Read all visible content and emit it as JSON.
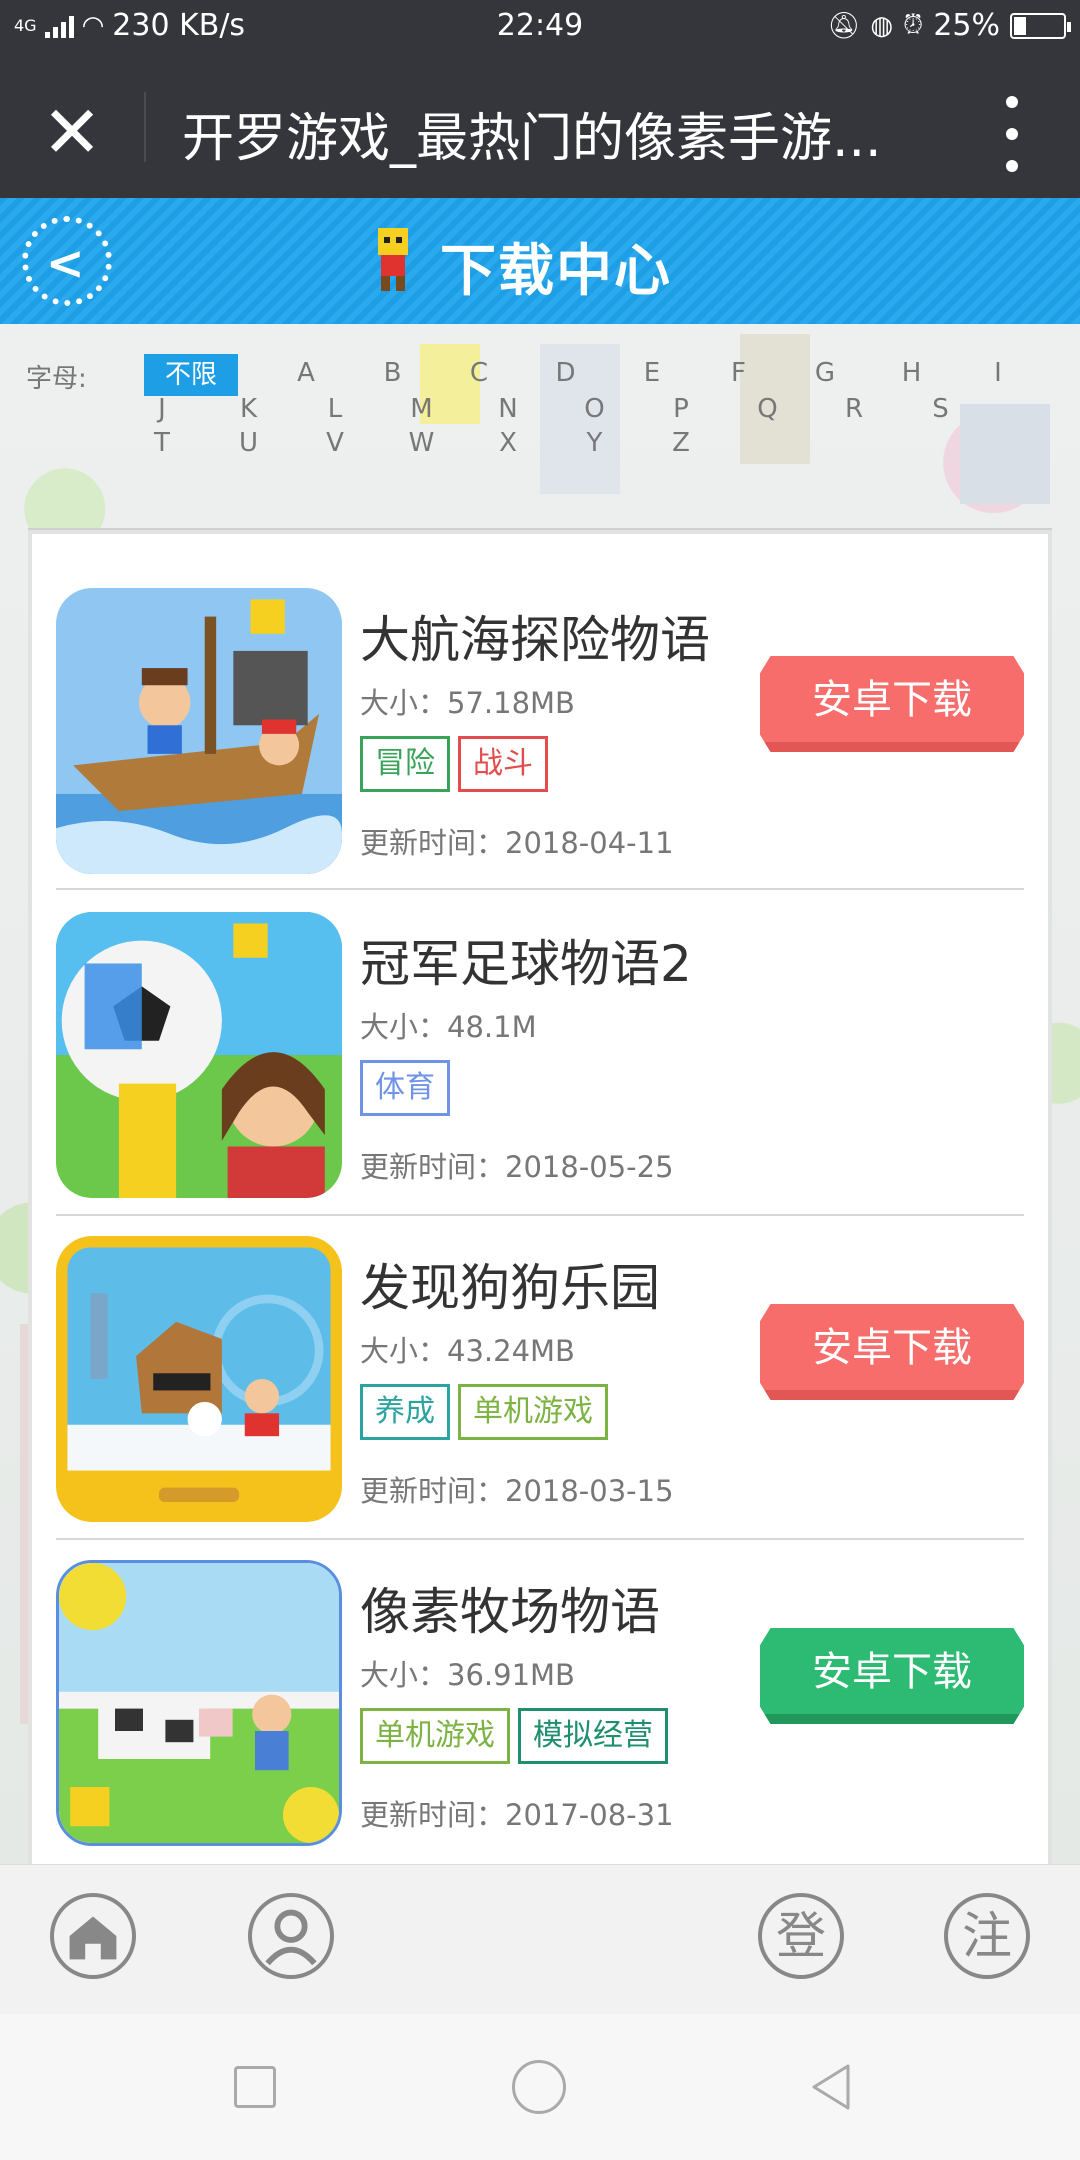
{
  "status_bar": {
    "network": "4G",
    "speed": "230 KB/s",
    "time": "22:49",
    "battery": "25%",
    "battery_level": 0.25
  },
  "title_bar": {
    "title": "开罗游戏_最热门的像素手游..."
  },
  "header": {
    "title": "下载中心"
  },
  "filter": {
    "label": "字母:",
    "selected": "不限",
    "letters": [
      "A",
      "B",
      "C",
      "D",
      "E",
      "F",
      "G",
      "H",
      "I",
      "J",
      "K",
      "L",
      "M",
      "N",
      "O",
      "P",
      "Q",
      "R",
      "S",
      "T",
      "U",
      "V",
      "W",
      "X",
      "Y",
      "Z"
    ]
  },
  "games": [
    {
      "name": "大航海探险物语",
      "size": "大小：57.18MB",
      "tags": [
        {
          "text": "冒险",
          "color": "#3aa35a"
        },
        {
          "text": "战斗",
          "color": "#e24c4c"
        }
      ],
      "date": "更新时间：2018-04-11",
      "button": "安卓下载",
      "button_color": "red"
    },
    {
      "name": "冠军足球物语2",
      "size": "大小：48.1M",
      "tags": [
        {
          "text": "体育",
          "color": "#6f93e6"
        }
      ],
      "date": "更新时间：2018-05-25",
      "button": "",
      "button_color": ""
    },
    {
      "name": "发现狗狗乐园",
      "size": "大小：43.24MB",
      "tags": [
        {
          "text": "养成",
          "color": "#2aa3a1"
        },
        {
          "text": "单机游戏",
          "color": "#7cb342"
        }
      ],
      "date": "更新时间：2018-03-15",
      "button": "安卓下载",
      "button_color": "red"
    },
    {
      "name": "像素牧场物语",
      "size": "大小：36.91MB",
      "tags": [
        {
          "text": "单机游戏",
          "color": "#7cb342"
        },
        {
          "text": "模拟经营",
          "color": "#1f8f6f"
        }
      ],
      "date": "更新时间：2017-08-31",
      "button": "安卓下载",
      "button_color": "green"
    }
  ],
  "bottom_bar": {
    "login": "登",
    "register": "注"
  }
}
